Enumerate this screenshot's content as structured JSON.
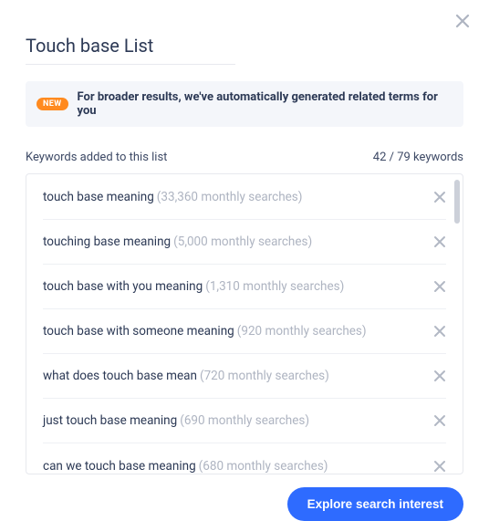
{
  "title": "Touch base List",
  "notice": {
    "badge": "NEW",
    "text": "For broader results, we've automatically generated related terms for you"
  },
  "subhead": {
    "label": "Keywords added to this list",
    "count_text": "42 / 79 keywords"
  },
  "keywords": [
    {
      "term": "touch base meaning",
      "volume": "(33,360 monthly searches)"
    },
    {
      "term": "touching base meaning",
      "volume": "(5,000 monthly searches)"
    },
    {
      "term": "touch base with you meaning",
      "volume": "(1,310 monthly searches)"
    },
    {
      "term": "touch base with someone meaning",
      "volume": "(920 monthly searches)"
    },
    {
      "term": "what does touch base mean",
      "volume": "(720 monthly searches)"
    },
    {
      "term": "just touch base meaning",
      "volume": "(690 monthly searches)"
    },
    {
      "term": "can we touch base meaning",
      "volume": "(680 monthly searches)"
    }
  ],
  "cta": "Explore search interest"
}
